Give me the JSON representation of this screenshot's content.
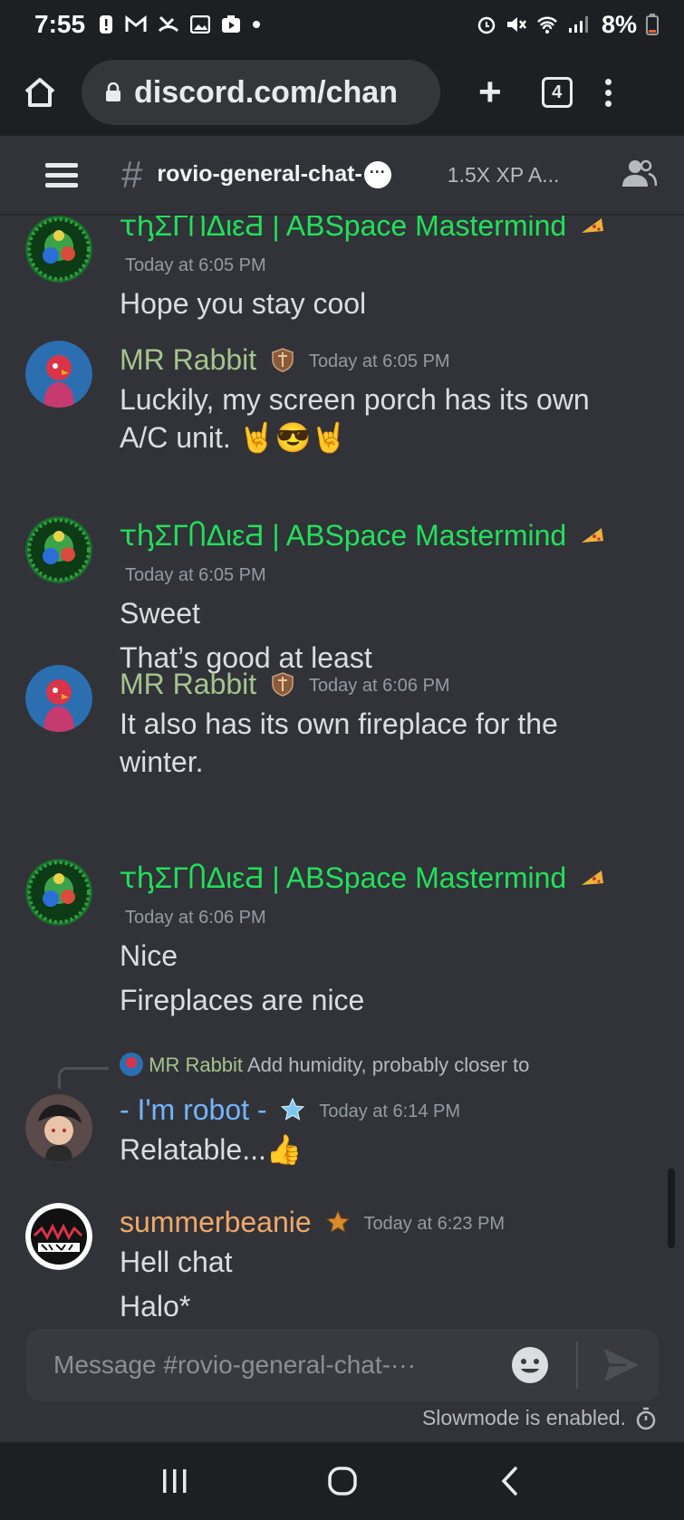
{
  "status": {
    "time": "7:55",
    "notification_icons": [
      "alert-icon",
      "gmail-icon",
      "missed-call-icon",
      "gallery-icon",
      "youtube-icon",
      "dot-icon"
    ],
    "battery": "8%"
  },
  "browser": {
    "url": "discord.com/chan",
    "tab_count": "4"
  },
  "channel": {
    "name": "rovio-general-chat-",
    "name_emoji": "···",
    "topic": "1.5X XP A..."
  },
  "messages": [
    {
      "author": "ꚍꞕΣГႶΔιεƋ | ABSpace Mastermind",
      "badge": "pizza-icon",
      "timestamp": "Today at 6:05 PM",
      "lines": [
        "Hope you stay cool"
      ]
    },
    {
      "author": "MR Rabbit",
      "badge": "shield-icon",
      "timestamp": "Today at 6:05 PM",
      "lines": [
        "Luckily, my screen porch has its own A/C unit. 🤘😎🤘"
      ]
    },
    {
      "author": "ꚍꞕΣГႶΔιεƋ | ABSpace Mastermind",
      "badge": "pizza-icon",
      "timestamp": "Today at 6:05 PM",
      "lines": [
        "Sweet",
        "That’s good at least"
      ]
    },
    {
      "author": "MR Rabbit",
      "badge": "shield-icon",
      "timestamp": "Today at 6:06 PM",
      "lines": [
        "It also has its own fireplace for the winter."
      ]
    },
    {
      "author": "ꚍꞕΣГႶΔιεƋ | ABSpace Mastermind",
      "badge": "pizza-icon",
      "timestamp": "Today at 6:06 PM",
      "lines": [
        "Nice",
        "Fireplaces are nice"
      ]
    },
    {
      "reply_to": {
        "author": "MR Rabbit",
        "preview": "Add humidity, probably closer to"
      },
      "author": "- I'm robot -",
      "badge": "star-icon",
      "timestamp": "Today at 6:14 PM",
      "lines": [
        "Relatable...👍"
      ]
    },
    {
      "author": "summerbeanie",
      "badge": "star-icon",
      "timestamp": "Today at 6:23 PM",
      "lines": [
        "Hell chat",
        "Halo*"
      ]
    }
  ],
  "composer": {
    "placeholder": "Message #rovio-general-chat-···",
    "slowmode": "Slowmode is enabled."
  },
  "colors": {
    "background": "#313338",
    "green_role": "#22e05b",
    "sage_role": "#a5c48f",
    "blue_role": "#73b4ff",
    "orange_role": "#f0a868",
    "text": "#dbdee1",
    "timestamp": "#949ba4"
  }
}
